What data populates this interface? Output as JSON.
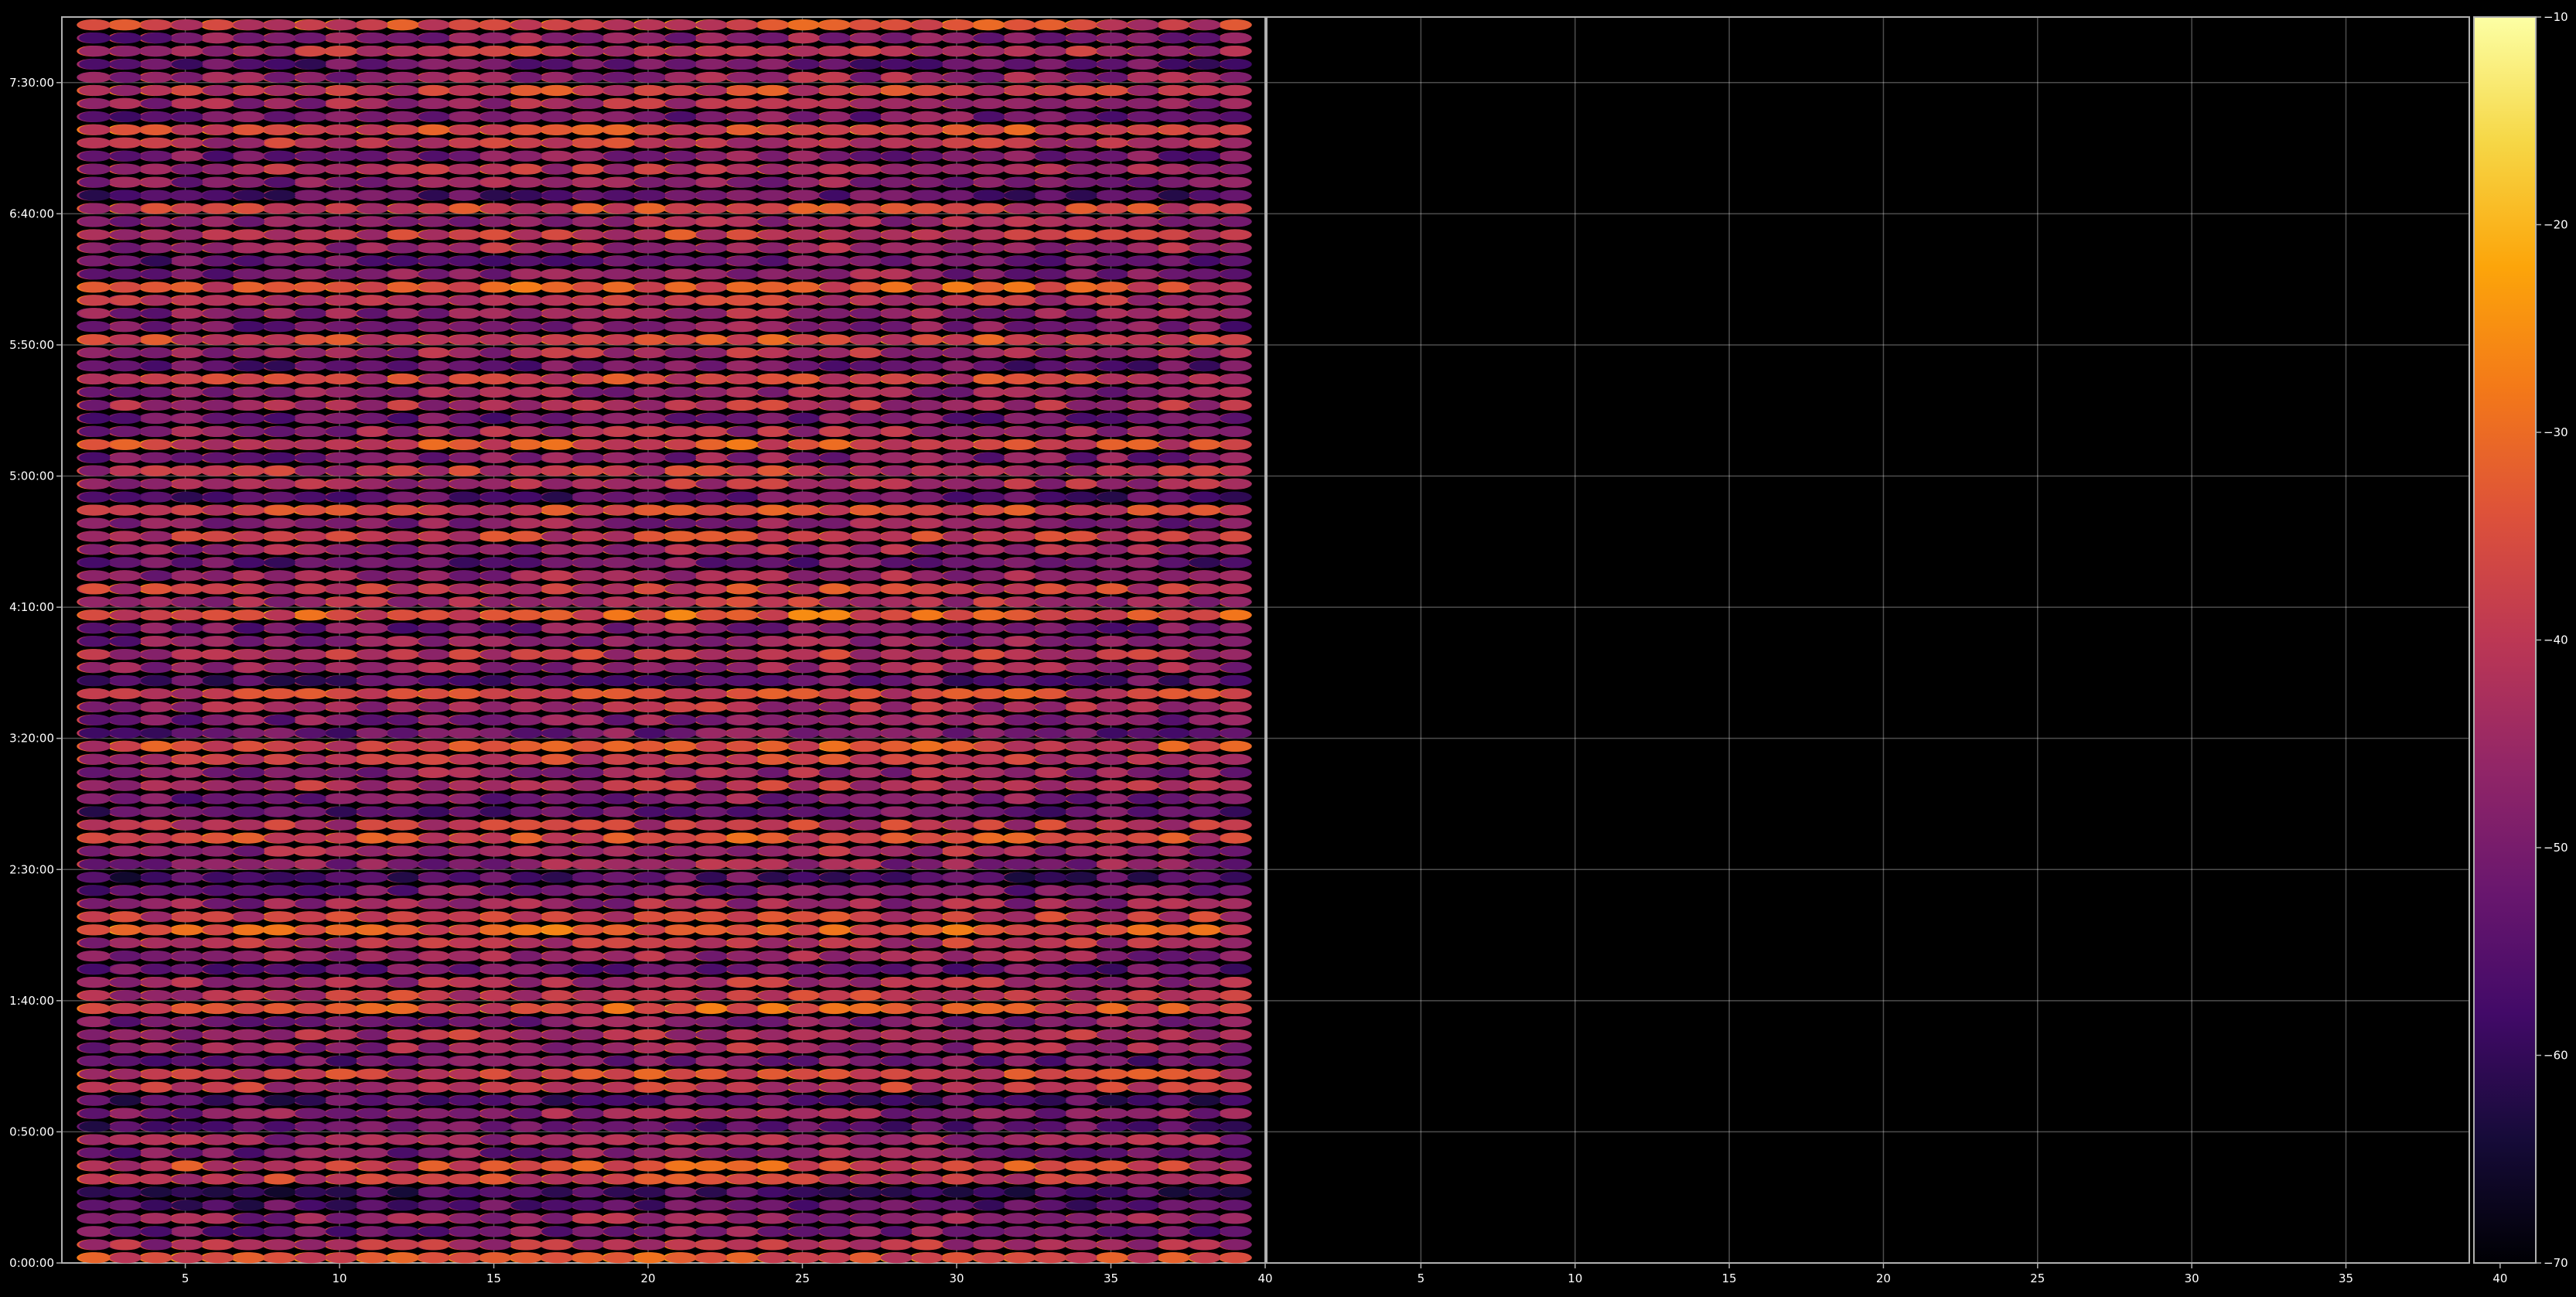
{
  "chart_data": {
    "type": "heatmap",
    "title": "",
    "xlabel": "",
    "ylabel": "",
    "colormap": "inferno",
    "colors": {
      "background": "#000000",
      "frame": "#b0b0b0",
      "gridline": "#ffffff",
      "text": "#ffffff"
    },
    "grid": true,
    "panels": [
      {
        "name": "",
        "xlim": [
          1,
          40
        ],
        "xticks": [
          5,
          10,
          15,
          20,
          25,
          30,
          35,
          40
        ],
        "columns": [
          2,
          39
        ],
        "level_offset": 0
      },
      {
        "name": "",
        "xlim": [
          40,
          79
        ],
        "xticks": [
          5,
          10,
          15,
          20,
          25,
          30,
          35,
          40
        ],
        "columns": [
          2,
          39
        ],
        "level_offset": -8
      }
    ],
    "y": {
      "range_minutes": [
        0,
        475
      ],
      "ticks": [
        {
          "minutes": 0,
          "label": "0:00:00"
        },
        {
          "minutes": 50,
          "label": "0:50:00"
        },
        {
          "minutes": 100,
          "label": "1:40:00"
        },
        {
          "minutes": 150,
          "label": "2:30:00"
        },
        {
          "minutes": 200,
          "label": "3:20:00"
        },
        {
          "minutes": 250,
          "label": "4:10:00"
        },
        {
          "minutes": 300,
          "label": "5:00:00"
        },
        {
          "minutes": 350,
          "label": "5:50:00"
        },
        {
          "minutes": 400,
          "label": "6:40:00"
        },
        {
          "minutes": 450,
          "label": "7:30:00"
        }
      ],
      "row_step_minutes": 5
    },
    "colorbar": {
      "range": [
        -70,
        -10
      ],
      "ticks": [
        -70,
        -60,
        -50,
        -40,
        -30,
        -20,
        -10
      ],
      "tick_labels": [
        "−70",
        "−60",
        "−50",
        "−40",
        "−30",
        "−20",
        "−10"
      ]
    },
    "values_db_approx": {
      "row_levels": [
        -26,
        -33,
        -41,
        -37,
        -45,
        -48,
        -29,
        -27,
        -40,
        -35,
        -44,
        -38,
        -46,
        -31,
        -28,
        -42,
        -36,
        -33,
        -39,
        -25,
        -30,
        -34,
        -43,
        -37,
        -32,
        -24,
        -29,
        -36,
        -41,
        -47,
        -38,
        -35,
        -27,
        -31,
        -44,
        -40,
        -33,
        -37,
        -30,
        -26,
        -42,
        -39,
        -34,
        -28,
        -45,
        -36,
        -32,
        -38,
        -41,
        -24,
        -33,
        -29,
        -37,
        -43,
        -35,
        -30,
        -39,
        -28,
        -46,
        -34,
        -31,
        -40,
        -26,
        -36,
        -42,
        -33,
        -38,
        -29,
        -44,
        -35,
        -27,
        -41,
        -37,
        -32,
        -25,
        -39,
        -43,
        -34,
        -30,
        -36,
        -28,
        -45,
        -38,
        -33,
        -40,
        -31,
        -26,
        -42,
        -35,
        -29,
        -37,
        -44,
        -32,
        -39,
        -27
      ],
      "column_trend": "peaks near columns 20-26"
    }
  }
}
